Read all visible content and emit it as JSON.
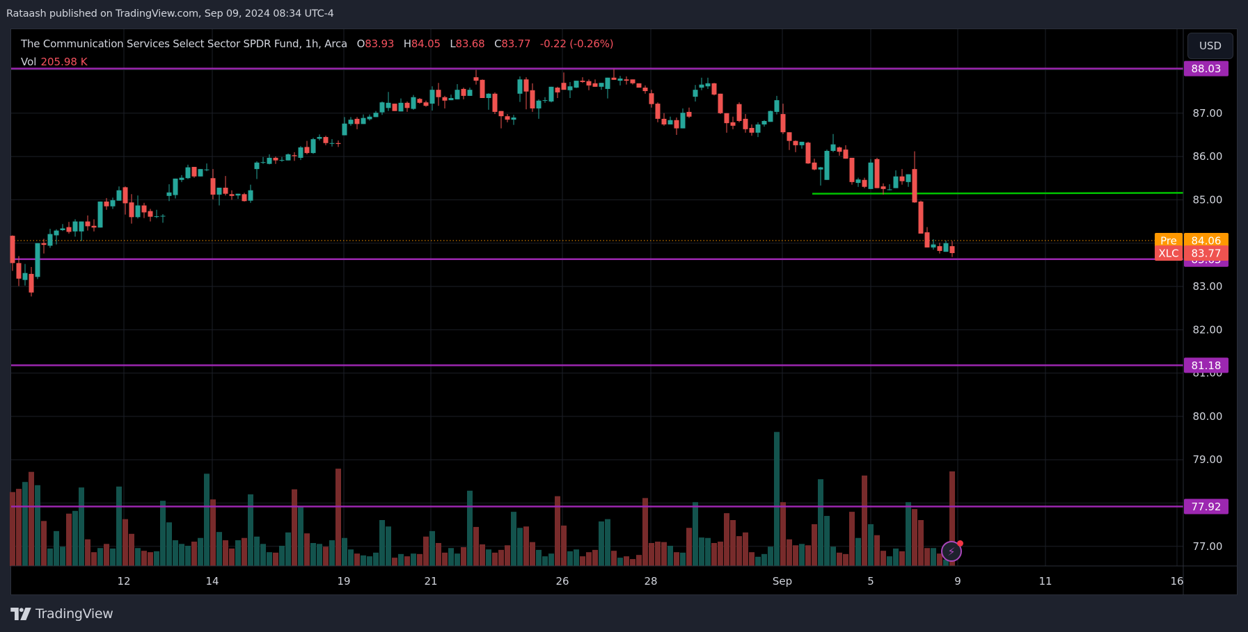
{
  "publisher_line": "Rataash published on TradingView.com, Sep 09, 2024 08:34 UTC-4",
  "legend": {
    "title": "The Communication Services Select Sector SPDR Fund, 1h, Arca",
    "o_label": "O",
    "o": "83.93",
    "h_label": "H",
    "h": "84.05",
    "l_label": "L",
    "l": "83.68",
    "c_label": "C",
    "c": "83.77",
    "change": "-0.22 (-0.26%)",
    "vol_label": "Vol",
    "vol": "205.98 K"
  },
  "currency_button": "USD",
  "logo_text": "TradingView",
  "colors": {
    "up": "#26a69a",
    "down": "#ef5350",
    "level": "#9c27b0",
    "trend": "#00c400",
    "pre": "#ff9800",
    "last": "#ef5350"
  },
  "price_axis": {
    "ticks": [
      "88.00",
      "87.00",
      "86.00",
      "85.00",
      "84.00",
      "83.00",
      "82.00",
      "81.00",
      "80.00",
      "79.00",
      "78.00",
      "77.00"
    ],
    "tick_values": [
      88,
      87,
      86,
      85,
      84,
      83,
      82,
      81,
      80,
      79,
      78,
      77
    ],
    "levels": [
      {
        "value": 88.03,
        "label": "88.03"
      },
      {
        "value": 83.63,
        "label": "83.63"
      },
      {
        "value": 81.18,
        "label": "81.18"
      },
      {
        "value": 77.92,
        "label": "77.92"
      }
    ],
    "pre": {
      "tag": "Pre",
      "value": 84.06,
      "label": "84.06"
    },
    "last": {
      "tag": "XLC",
      "value": 83.77,
      "label": "83.77"
    }
  },
  "time_axis": [
    "12",
    "14",
    "19",
    "21",
    "26",
    "28",
    "Sep",
    "5",
    "9",
    "11",
    "16"
  ],
  "icons": {
    "alert": "lightning-bolt-icon",
    "logo": "tradingview-logo-icon"
  },
  "chart_data": {
    "type": "candlestick",
    "symbol": "XLC",
    "interval": "1h",
    "ohlc_columns": [
      "open",
      "high",
      "low",
      "close"
    ],
    "ohlc": [
      [
        84.17,
        84.18,
        83.36,
        83.54
      ],
      [
        83.54,
        83.7,
        83.01,
        83.18
      ],
      [
        83.15,
        83.52,
        83.02,
        83.31
      ],
      [
        83.29,
        83.45,
        82.77,
        82.86
      ],
      [
        83.22,
        84.0,
        83.17,
        84.0
      ],
      [
        84.0,
        84.1,
        83.76,
        83.96
      ],
      [
        83.94,
        84.33,
        83.89,
        84.21
      ],
      [
        84.18,
        84.32,
        83.97,
        84.29
      ],
      [
        84.3,
        84.44,
        84.28,
        84.34
      ],
      [
        84.37,
        84.49,
        84.22,
        84.26
      ],
      [
        84.27,
        84.55,
        84.15,
        84.5
      ],
      [
        84.27,
        84.5,
        84.05,
        84.5
      ],
      [
        84.5,
        84.64,
        84.29,
        84.39
      ],
      [
        84.4,
        84.55,
        84.27,
        84.36
      ],
      [
        84.36,
        84.96,
        84.36,
        84.96
      ],
      [
        84.96,
        85.04,
        84.77,
        84.85
      ],
      [
        84.85,
        85.05,
        84.79,
        84.99
      ],
      [
        84.98,
        85.31,
        84.98,
        85.22
      ],
      [
        85.29,
        85.31,
        84.66,
        84.92
      ],
      [
        84.94,
        85.13,
        84.45,
        84.6
      ],
      [
        84.6,
        85.1,
        84.57,
        84.87
      ],
      [
        84.87,
        84.93,
        84.58,
        84.71
      ],
      [
        84.74,
        84.79,
        84.5,
        84.61
      ],
      [
        84.62,
        84.77,
        84.58,
        84.62
      ],
      [
        84.62,
        84.67,
        84.47,
        84.63
      ],
      [
        85.09,
        85.36,
        84.97,
        85.17
      ],
      [
        85.11,
        85.49,
        85.03,
        85.49
      ],
      [
        85.46,
        85.57,
        85.41,
        85.51
      ],
      [
        85.5,
        85.81,
        85.48,
        85.75
      ],
      [
        85.76,
        85.76,
        85.51,
        85.54
      ],
      [
        85.54,
        85.71,
        85.54,
        85.71
      ],
      [
        85.7,
        85.84,
        85.66,
        85.7
      ],
      [
        85.5,
        85.71,
        85.01,
        85.12
      ],
      [
        85.12,
        85.28,
        84.87,
        85.28
      ],
      [
        85.28,
        85.55,
        85.1,
        85.14
      ],
      [
        85.13,
        85.22,
        85.0,
        85.09
      ],
      [
        85.1,
        85.14,
        85.02,
        85.14
      ],
      [
        85.13,
        85.16,
        84.96,
        84.97
      ],
      [
        84.98,
        85.35,
        84.93,
        85.22
      ],
      [
        85.71,
        85.89,
        85.48,
        85.86
      ],
      [
        85.87,
        85.99,
        85.83,
        85.87
      ],
      [
        85.83,
        86.05,
        85.82,
        85.97
      ],
      [
        85.97,
        86.0,
        85.83,
        85.91
      ],
      [
        85.92,
        85.99,
        85.88,
        85.92
      ],
      [
        85.91,
        86.07,
        85.91,
        86.05
      ],
      [
        86.03,
        86.1,
        85.9,
        86.01
      ],
      [
        85.97,
        86.24,
        85.92,
        86.21
      ],
      [
        86.22,
        86.36,
        86.05,
        86.08
      ],
      [
        86.08,
        86.43,
        86.06,
        86.4
      ],
      [
        86.41,
        86.51,
        86.37,
        86.45
      ],
      [
        86.45,
        86.48,
        86.26,
        86.31
      ],
      [
        86.31,
        86.4,
        86.23,
        86.31
      ],
      [
        86.31,
        86.37,
        86.22,
        86.29
      ],
      [
        86.49,
        86.91,
        86.49,
        86.76
      ],
      [
        86.75,
        86.91,
        86.71,
        86.85
      ],
      [
        86.87,
        86.91,
        86.63,
        86.75
      ],
      [
        86.75,
        86.97,
        86.75,
        86.89
      ],
      [
        86.86,
        86.97,
        86.83,
        86.92
      ],
      [
        86.91,
        87.05,
        86.91,
        87.01
      ],
      [
        87.02,
        87.27,
        86.96,
        87.25
      ],
      [
        87.12,
        87.49,
        87.05,
        87.24
      ],
      [
        87.22,
        87.22,
        87.05,
        87.05
      ],
      [
        87.04,
        87.34,
        87.04,
        87.24
      ],
      [
        87.24,
        87.27,
        87.03,
        87.12
      ],
      [
        87.1,
        87.42,
        87.08,
        87.37
      ],
      [
        87.33,
        87.35,
        87.22,
        87.24
      ],
      [
        87.25,
        87.29,
        87.15,
        87.17
      ],
      [
        87.22,
        87.62,
        87.06,
        87.54
      ],
      [
        87.54,
        87.7,
        87.17,
        87.37
      ],
      [
        87.37,
        87.4,
        87.11,
        87.29
      ],
      [
        87.3,
        87.43,
        87.3,
        87.35
      ],
      [
        87.32,
        87.67,
        87.32,
        87.54
      ],
      [
        87.56,
        87.59,
        87.32,
        87.4
      ],
      [
        87.4,
        87.59,
        87.4,
        87.54
      ],
      [
        87.83,
        88.0,
        87.66,
        87.75
      ],
      [
        87.77,
        87.78,
        87.35,
        87.35
      ],
      [
        87.35,
        87.46,
        87.08,
        87.45
      ],
      [
        87.45,
        87.48,
        86.98,
        87.03
      ],
      [
        87.05,
        87.05,
        86.65,
        86.93
      ],
      [
        86.93,
        86.98,
        86.79,
        86.85
      ],
      [
        86.85,
        86.96,
        86.73,
        86.9
      ],
      [
        87.45,
        87.85,
        87.26,
        87.78
      ],
      [
        87.78,
        87.83,
        87.09,
        87.5
      ],
      [
        87.53,
        87.69,
        87.03,
        87.11
      ],
      [
        87.11,
        87.32,
        86.87,
        87.29
      ],
      [
        87.3,
        87.37,
        87.24,
        87.3
      ],
      [
        87.27,
        87.61,
        87.25,
        87.61
      ],
      [
        87.59,
        87.61,
        87.35,
        87.48
      ],
      [
        87.7,
        87.94,
        87.54,
        87.54
      ],
      [
        87.53,
        87.72,
        87.35,
        87.62
      ],
      [
        87.59,
        87.75,
        87.58,
        87.75
      ],
      [
        87.75,
        87.83,
        87.7,
        87.72
      ],
      [
        87.74,
        87.78,
        87.53,
        87.64
      ],
      [
        87.69,
        87.78,
        87.61,
        87.61
      ],
      [
        87.61,
        87.7,
        87.54,
        87.7
      ],
      [
        87.56,
        87.82,
        87.34,
        87.82
      ],
      [
        87.82,
        88.02,
        87.77,
        87.77
      ],
      [
        87.75,
        87.86,
        87.64,
        87.8
      ],
      [
        87.78,
        87.85,
        87.66,
        87.75
      ],
      [
        87.78,
        87.78,
        87.66,
        87.69
      ],
      [
        87.69,
        87.69,
        87.59,
        87.59
      ],
      [
        87.59,
        87.64,
        87.45,
        87.51
      ],
      [
        87.46,
        87.54,
        87.13,
        87.21
      ],
      [
        87.22,
        87.25,
        86.79,
        86.87
      ],
      [
        86.87,
        87.0,
        86.71,
        86.74
      ],
      [
        86.74,
        86.92,
        86.74,
        86.84
      ],
      [
        86.84,
        86.9,
        86.5,
        86.65
      ],
      [
        86.65,
        87.11,
        86.65,
        87.01
      ],
      [
        87.03,
        87.13,
        86.89,
        86.92
      ],
      [
        87.38,
        87.65,
        87.27,
        87.54
      ],
      [
        87.59,
        87.82,
        87.53,
        87.66
      ],
      [
        87.62,
        87.82,
        87.56,
        87.69
      ],
      [
        87.69,
        87.7,
        87.41,
        87.43
      ],
      [
        87.45,
        87.45,
        86.98,
        87.0
      ],
      [
        87.0,
        87.0,
        86.55,
        86.77
      ],
      [
        86.79,
        86.92,
        86.63,
        86.71
      ],
      [
        87.21,
        87.25,
        86.79,
        86.82
      ],
      [
        86.87,
        86.98,
        86.55,
        86.63
      ],
      [
        86.66,
        86.74,
        86.48,
        86.55
      ],
      [
        86.55,
        86.79,
        86.45,
        86.74
      ],
      [
        86.74,
        86.84,
        86.69,
        86.82
      ],
      [
        86.8,
        87.06,
        86.8,
        87.05
      ],
      [
        87.03,
        87.4,
        86.97,
        87.3
      ],
      [
        86.98,
        87.22,
        86.52,
        86.56
      ],
      [
        86.56,
        86.56,
        86.15,
        86.36
      ],
      [
        86.36,
        86.37,
        86.1,
        86.26
      ],
      [
        86.26,
        86.34,
        86.18,
        86.34
      ],
      [
        86.32,
        86.34,
        85.83,
        85.84
      ],
      [
        85.86,
        85.95,
        85.68,
        85.7
      ],
      [
        85.7,
        85.76,
        85.33,
        85.75
      ],
      [
        85.46,
        86.16,
        85.46,
        86.13
      ],
      [
        86.13,
        86.52,
        86.1,
        86.28
      ],
      [
        86.21,
        86.23,
        86.02,
        86.11
      ],
      [
        86.16,
        86.26,
        85.95,
        85.95
      ],
      [
        85.97,
        85.97,
        85.35,
        85.41
      ],
      [
        85.39,
        85.51,
        85.3,
        85.47
      ],
      [
        85.46,
        85.51,
        85.27,
        85.3
      ],
      [
        85.25,
        85.94,
        85.25,
        85.86
      ],
      [
        85.94,
        85.97,
        85.27,
        85.27
      ],
      [
        85.31,
        85.38,
        85.12,
        85.25
      ],
      [
        85.24,
        85.36,
        85.22,
        85.24
      ],
      [
        85.27,
        85.68,
        85.27,
        85.54
      ],
      [
        85.54,
        85.71,
        85.35,
        85.43
      ],
      [
        85.41,
        85.59,
        85.3,
        85.59
      ],
      [
        85.71,
        86.12,
        84.93,
        84.94
      ],
      [
        84.96,
        84.98,
        84.22,
        84.22
      ],
      [
        84.25,
        84.37,
        83.9,
        83.9
      ],
      [
        83.9,
        84.09,
        83.85,
        83.97
      ],
      [
        83.93,
        84.01,
        83.76,
        83.82
      ],
      [
        83.8,
        84.06,
        83.8,
        84.0
      ],
      [
        83.93,
        84.05,
        83.68,
        83.77
      ]
    ],
    "volume_unit": "K",
    "volume": [
      161,
      168,
      183,
      205,
      176,
      98,
      38,
      76,
      42,
      114,
      120,
      171,
      58,
      30,
      39,
      48,
      38,
      173,
      102,
      70,
      39,
      33,
      30,
      32,
      142,
      95,
      56,
      48,
      44,
      53,
      61,
      201,
      145,
      74,
      56,
      38,
      56,
      61,
      156,
      64,
      48,
      30,
      29,
      44,
      73,
      167,
      130,
      71,
      50,
      48,
      42,
      56,
      212,
      61,
      36,
      27,
      23,
      21,
      29,
      100,
      86,
      18,
      26,
      21,
      27,
      26,
      64,
      76,
      50,
      29,
      39,
      27,
      41,
      164,
      85,
      47,
      36,
      29,
      35,
      45,
      118,
      83,
      86,
      52,
      35,
      21,
      27,
      152,
      88,
      32,
      36,
      21,
      30,
      35,
      97,
      102,
      33,
      18,
      21,
      15,
      24,
      148,
      50,
      53,
      52,
      44,
      30,
      29,
      83,
      139,
      62,
      61,
      50,
      53,
      115,
      100,
      65,
      73,
      30,
      20,
      26,
      42,
      292,
      139,
      58,
      45,
      48,
      45,
      91,
      189,
      109,
      42,
      29,
      26,
      118,
      61,
      197,
      91,
      67,
      33,
      21,
      38,
      32,
      139,
      124,
      100,
      39,
      39,
      27,
      14,
      206
    ],
    "trend_line": {
      "from_price": 85.14,
      "to_price": 85.16
    },
    "y_range": [
      76.5,
      88.6
    ],
    "grid": true
  }
}
